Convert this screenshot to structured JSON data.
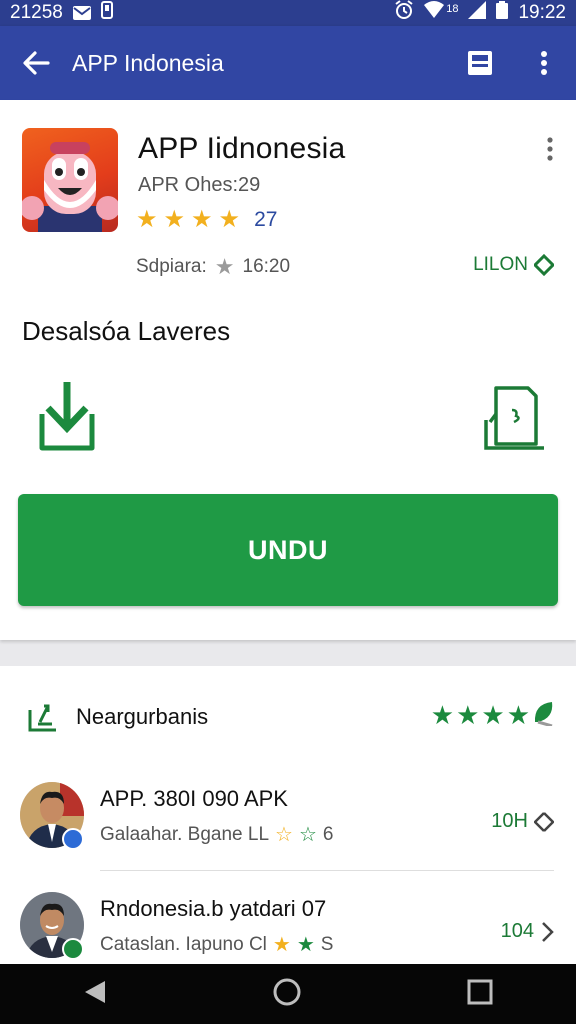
{
  "status_bar": {
    "carrier_text": "21258",
    "small_label": "18",
    "time": "19:22"
  },
  "app_bar": {
    "title": "APP Indonesia"
  },
  "app": {
    "name": "APP Iidnonesia",
    "subtitle": "APR Ohes:29",
    "rating_count": "27",
    "meta_label": "Sdpiara:",
    "meta_value": "16:20",
    "size_label": "LILON"
  },
  "download_section": {
    "title": "Desalsóa Laveres",
    "button_label": "UNDU"
  },
  "related": {
    "title": "Neargurbanis",
    "items": [
      {
        "title": "APP. 380I 090 APK",
        "subtitle": "Galaahar. Bgane LL",
        "rating": "6",
        "size": "10H"
      },
      {
        "title": "Rndonesia.b yatdari 07",
        "subtitle": "Cataslan. Iapuno Cl",
        "rating": "S",
        "size": "104"
      }
    ]
  },
  "colors": {
    "status_bar": "#2c3e8f",
    "app_bar": "#3146a3",
    "accent_green": "#1f9a45",
    "star_yellow": "#f2b01e",
    "nav_bar": "#060606"
  },
  "icons": [
    "back-arrow-icon",
    "save-icon",
    "overflow-menu-icon",
    "download-icon",
    "file-icon",
    "chevron-right-icon",
    "nav-back-icon",
    "nav-home-icon",
    "nav-recents-icon"
  ]
}
